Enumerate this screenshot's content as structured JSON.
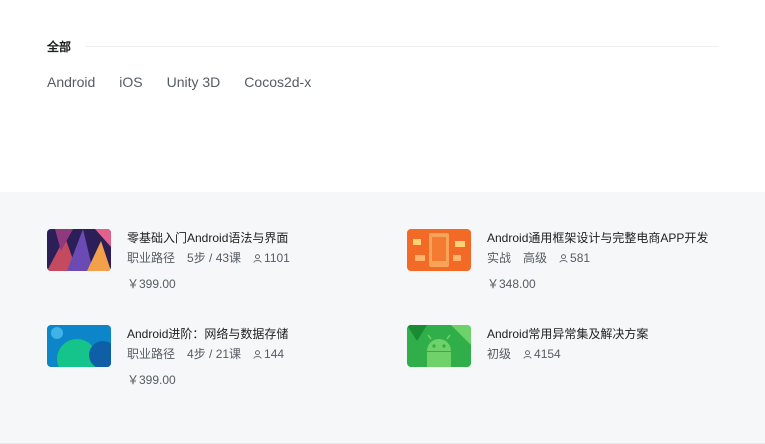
{
  "category": {
    "title": "全部",
    "tags": [
      "Android",
      "iOS",
      "Unity 3D",
      "Cocos2d-x"
    ]
  },
  "courses": [
    {
      "title": "零基础入门Android语法与界面",
      "meta1": "职业路径",
      "meta2": "5步 / 43课",
      "students": "1101",
      "price": "￥399.00",
      "thumb_colors": [
        "#2c1f57",
        "#c34a5f",
        "#f3a04a"
      ]
    },
    {
      "title": "Android通用框架设计与完整电商APP开发",
      "meta1": "实战",
      "meta2": "高级",
      "students": "581",
      "price": "￥348.00",
      "thumb_colors": [
        "#f26a26",
        "#f8a35a",
        "#ffd07a"
      ]
    },
    {
      "title": "Android进阶：网络与数据存储",
      "meta1": "职业路径",
      "meta2": "4步 / 21课",
      "students": "144",
      "price": "￥399.00",
      "thumb_colors": [
        "#0c86c8",
        "#14c48b",
        "#0e5fa5"
      ]
    },
    {
      "title": "Android常用异常集及解决方案",
      "meta1": "初级",
      "meta2": "",
      "students": "4154",
      "price": "",
      "thumb_colors": [
        "#2fae4a",
        "#6fd16a",
        "#1b8a35"
      ]
    }
  ]
}
